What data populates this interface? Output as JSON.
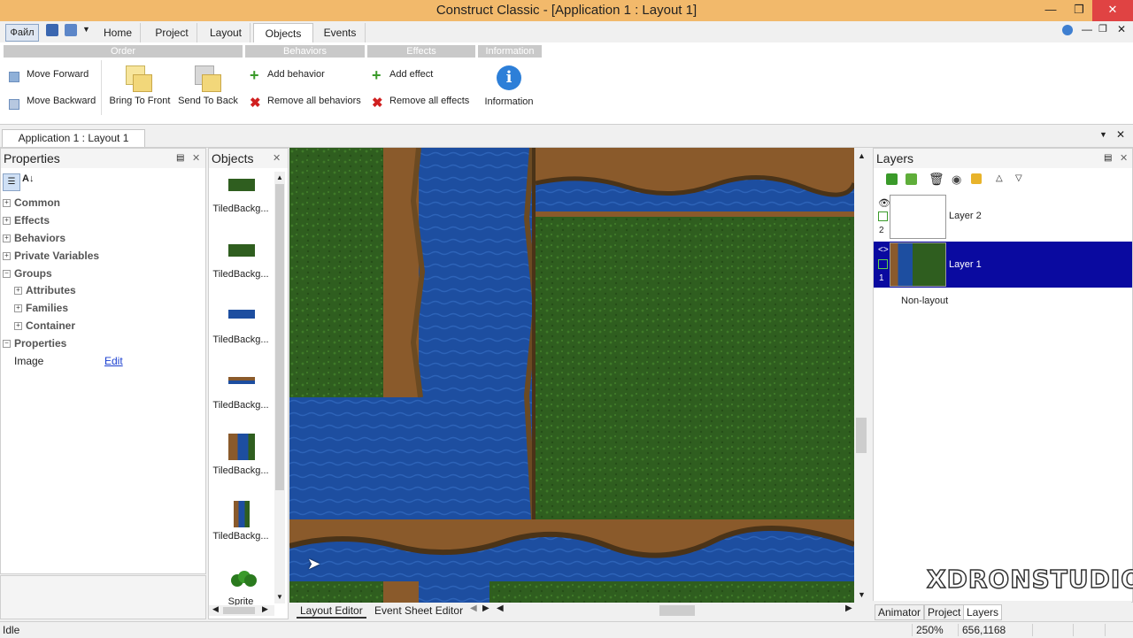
{
  "window": {
    "title": "Construct Classic - [Application 1 : Layout 1]"
  },
  "ribbon": {
    "file_label": "Файл",
    "tabs": [
      {
        "label": "Home"
      },
      {
        "label": "Project"
      },
      {
        "label": "Layout"
      },
      {
        "label": "Objects"
      },
      {
        "label": "Events"
      }
    ],
    "active_tab": "Objects",
    "groups": {
      "order": "Order",
      "behaviors": "Behaviors",
      "effects": "Effects",
      "information": "Information"
    },
    "buttons": {
      "move_forward": "Move Forward",
      "move_backward": "Move Backward",
      "bring_to_front": "Bring To Front",
      "send_to_back": "Send To Back",
      "add_behavior": "Add behavior",
      "remove_behaviors": "Remove all behaviors",
      "add_effect": "Add effect",
      "remove_effects": "Remove all effects",
      "information": "Information"
    }
  },
  "document_tab": {
    "label": "Application 1 : Layout 1"
  },
  "properties": {
    "title": "Properties",
    "sections": [
      {
        "label": "Common"
      },
      {
        "label": "Effects"
      },
      {
        "label": "Behaviors"
      },
      {
        "label": "Private Variables"
      },
      {
        "label": "Groups"
      }
    ],
    "group_items": [
      {
        "label": "Attributes"
      },
      {
        "label": "Families"
      },
      {
        "label": "Container"
      }
    ],
    "props_label": "Properties",
    "image_label": "Image",
    "image_value": "Edit"
  },
  "objects": {
    "title": "Objects",
    "items": [
      {
        "label": "TiledBackg..."
      },
      {
        "label": "TiledBackg..."
      },
      {
        "label": "TiledBackg..."
      },
      {
        "label": "TiledBackg..."
      },
      {
        "label": "TiledBackg..."
      },
      {
        "label": "TiledBackg..."
      },
      {
        "label": "Sprite"
      }
    ]
  },
  "editor_tabs": {
    "layout": "Layout Editor",
    "events": "Event Sheet Editor"
  },
  "layers": {
    "title": "Layers",
    "items": [
      {
        "name": "Layer 2",
        "index": "2"
      },
      {
        "name": "Layer 1",
        "index": "1"
      }
    ],
    "non_layout": "Non-layout"
  },
  "bottom_tabs": {
    "animator": "Animator",
    "project": "Project",
    "layers": "Layers"
  },
  "watermark": "XDRONSTUDIO",
  "status": {
    "text": "Idle",
    "zoom": "250%",
    "coords": "656,1168"
  },
  "colors": {
    "titlebar": "#f2b96b",
    "selection": "#0a0aa0",
    "water": "#1d4ea0",
    "grass": "#2f5e1f",
    "dirt": "#8a5a2b"
  }
}
